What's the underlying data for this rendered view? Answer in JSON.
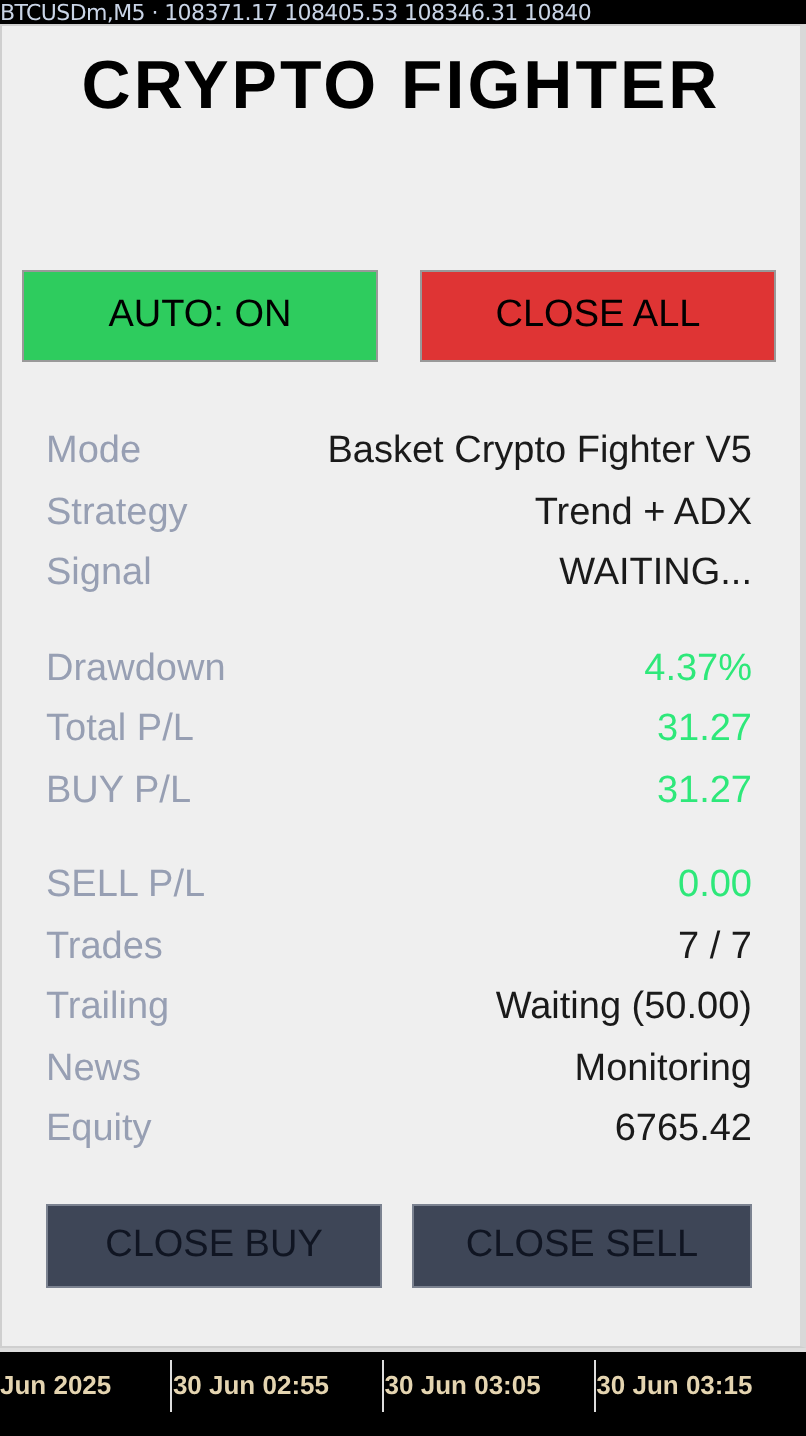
{
  "chart_header": {
    "text": "BTCUSDm,M5 · 108371.17 108405.53 108346.31 10840"
  },
  "panel": {
    "title": "CRYPTO FIGHTER",
    "top_buttons": [
      {
        "label": "AUTO: ON",
        "kind": "auto"
      },
      {
        "label": "CLOSE ALL",
        "kind": "danger"
      }
    ],
    "groups": [
      {
        "rows": [
          {
            "label": "Mode",
            "value": "Basket Crypto Fighter V5",
            "color": "#1a1a1a"
          },
          {
            "label": "Strategy",
            "value": "Trend + ADX",
            "color": "#1a1a1a"
          },
          {
            "label": "Signal",
            "value": "WAITING...",
            "color": "#1a1a1a"
          }
        ]
      },
      {
        "rows": [
          {
            "label": "Drawdown",
            "value": "4.37%",
            "color": "#2ee87a"
          },
          {
            "label": "Total P/L",
            "value": "31.27",
            "color": "#2ee87a"
          },
          {
            "label": "BUY P/L",
            "value": "31.27",
            "color": "#2ee87a"
          }
        ]
      },
      {
        "rows": [
          {
            "label": "SELL P/L",
            "value": "0.00",
            "color": "#2ee87a"
          },
          {
            "label": "Trades",
            "value": "7 / 7",
            "color": "#1a1a1a"
          },
          {
            "label": "Trailing",
            "value": "Waiting (50.00)",
            "color": "#1a1a1a"
          },
          {
            "label": "News",
            "value": "Monitoring",
            "color": "#1a1a1a"
          },
          {
            "label": "Equity",
            "value": "6765.42",
            "color": "#1a1a1a"
          }
        ]
      }
    ],
    "bottom_buttons": [
      {
        "label": "CLOSE BUY"
      },
      {
        "label": "CLOSE SELL"
      }
    ]
  },
  "time_axis": [
    "Jun 2025",
    "30 Jun 02:55",
    "30 Jun 03:05",
    "30 Jun 03:15"
  ]
}
